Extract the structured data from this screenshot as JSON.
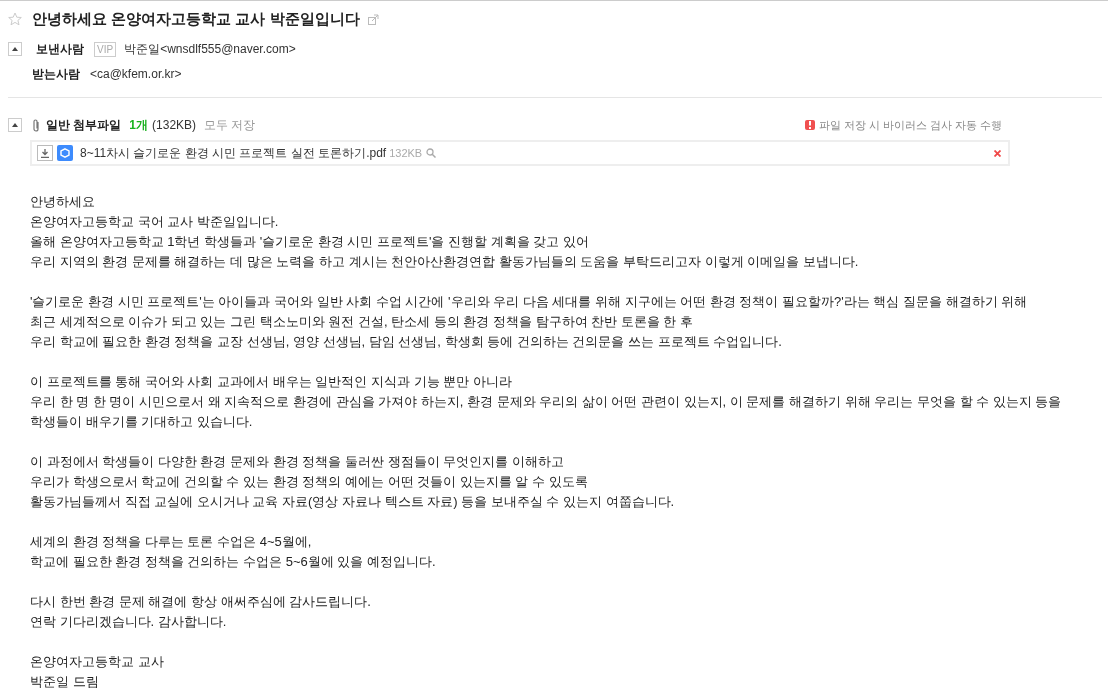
{
  "subject": {
    "title": "안녕하세요 온양여자고등학교 교사 박준일입니다",
    "starred": false
  },
  "sender": {
    "label": "보낸사람",
    "badge": "VIP",
    "value": "박준일<wnsdlf555@naver.com>",
    "expanded": true
  },
  "recipient": {
    "label": "받는사람",
    "value": "<ca@kfem.or.kr>"
  },
  "attachments": {
    "expanded": true,
    "label": "일반 첨부파일",
    "count": "1개",
    "size": "(132KB)",
    "save_all": "모두 저장",
    "notice": "파일 저장 시 바이러스 검사 자동 수행",
    "files": [
      {
        "name": "8~11차시 슬기로운 환경 시민 프로젝트 실전 토론하기.pdf",
        "size": "132KB"
      }
    ]
  },
  "body": [
    [
      "안녕하세요",
      "온양여자고등학교 국어 교사 박준일입니다.",
      "올해 온양여자고등학교 1학년 학생들과 '슬기로운 환경 시민 프로젝트'을 진행할 계획을 갖고 있어",
      "우리 지역의 환경 문제를 해결하는 데 많은 노력을 하고 계시는 천안아산환경연합 활동가님들의 도움을 부탁드리고자 이렇게 이메일을 보냅니다."
    ],
    [
      "'슬기로운 환경 시민 프로젝트'는 아이들과 국어와 일반 사회 수업 시간에 '우리와 우리 다음 세대를 위해 지구에는 어떤 환경 정책이 필요할까?'라는 핵심 질문을 해결하기 위해",
      "최근 세계적으로 이슈가 되고 있는 그린 택소노미와 원전 건설, 탄소세 등의 환경 정책을 탐구하여 찬반 토론을 한 후",
      "우리 학교에 필요한 환경 정책을 교장 선생님, 영양 선생님, 담임 선생님, 학생회 등에 건의하는 건의문을 쓰는 프로젝트 수업입니다."
    ],
    [
      "이 프로젝트를 통해 국어와 사회 교과에서 배우는 일반적인 지식과 기능 뿐만 아니라",
      "우리 한 명 한 명이 시민으로서 왜 지속적으로 환경에 관심을 가져야 하는지, 환경 문제와 우리의 삶이 어떤 관련이 있는지, 이 문제를 해결하기 위해 우리는 무엇을 할 수 있는지 등을",
      "학생들이 배우기를 기대하고 있습니다."
    ],
    [
      "이 과정에서 학생들이 다양한 환경 문제와 환경 정책을 둘러싼 쟁점들이 무엇인지를 이해하고",
      "우리가 학생으로서 학교에 건의할 수 있는 환경 정책의 예에는 어떤 것들이 있는지를 알 수 있도록",
      "활동가님들께서 직접 교실에 오시거나 교육 자료(영상 자료나 텍스트 자료) 등을 보내주실 수 있는지 여쭙습니다."
    ],
    [
      "세계의 환경 정책을 다루는 토론 수업은 4~5월에,",
      "학교에 필요한 환경 정책을 건의하는 수업은 5~6월에 있을 예정입니다."
    ],
    [
      "다시 한번 환경 문제 해결에 항상 애써주심에 감사드립니다.",
      "연락 기다리겠습니다. 감사합니다."
    ],
    [
      "온양여자고등학교 교사",
      "박준일 드림"
    ]
  ]
}
